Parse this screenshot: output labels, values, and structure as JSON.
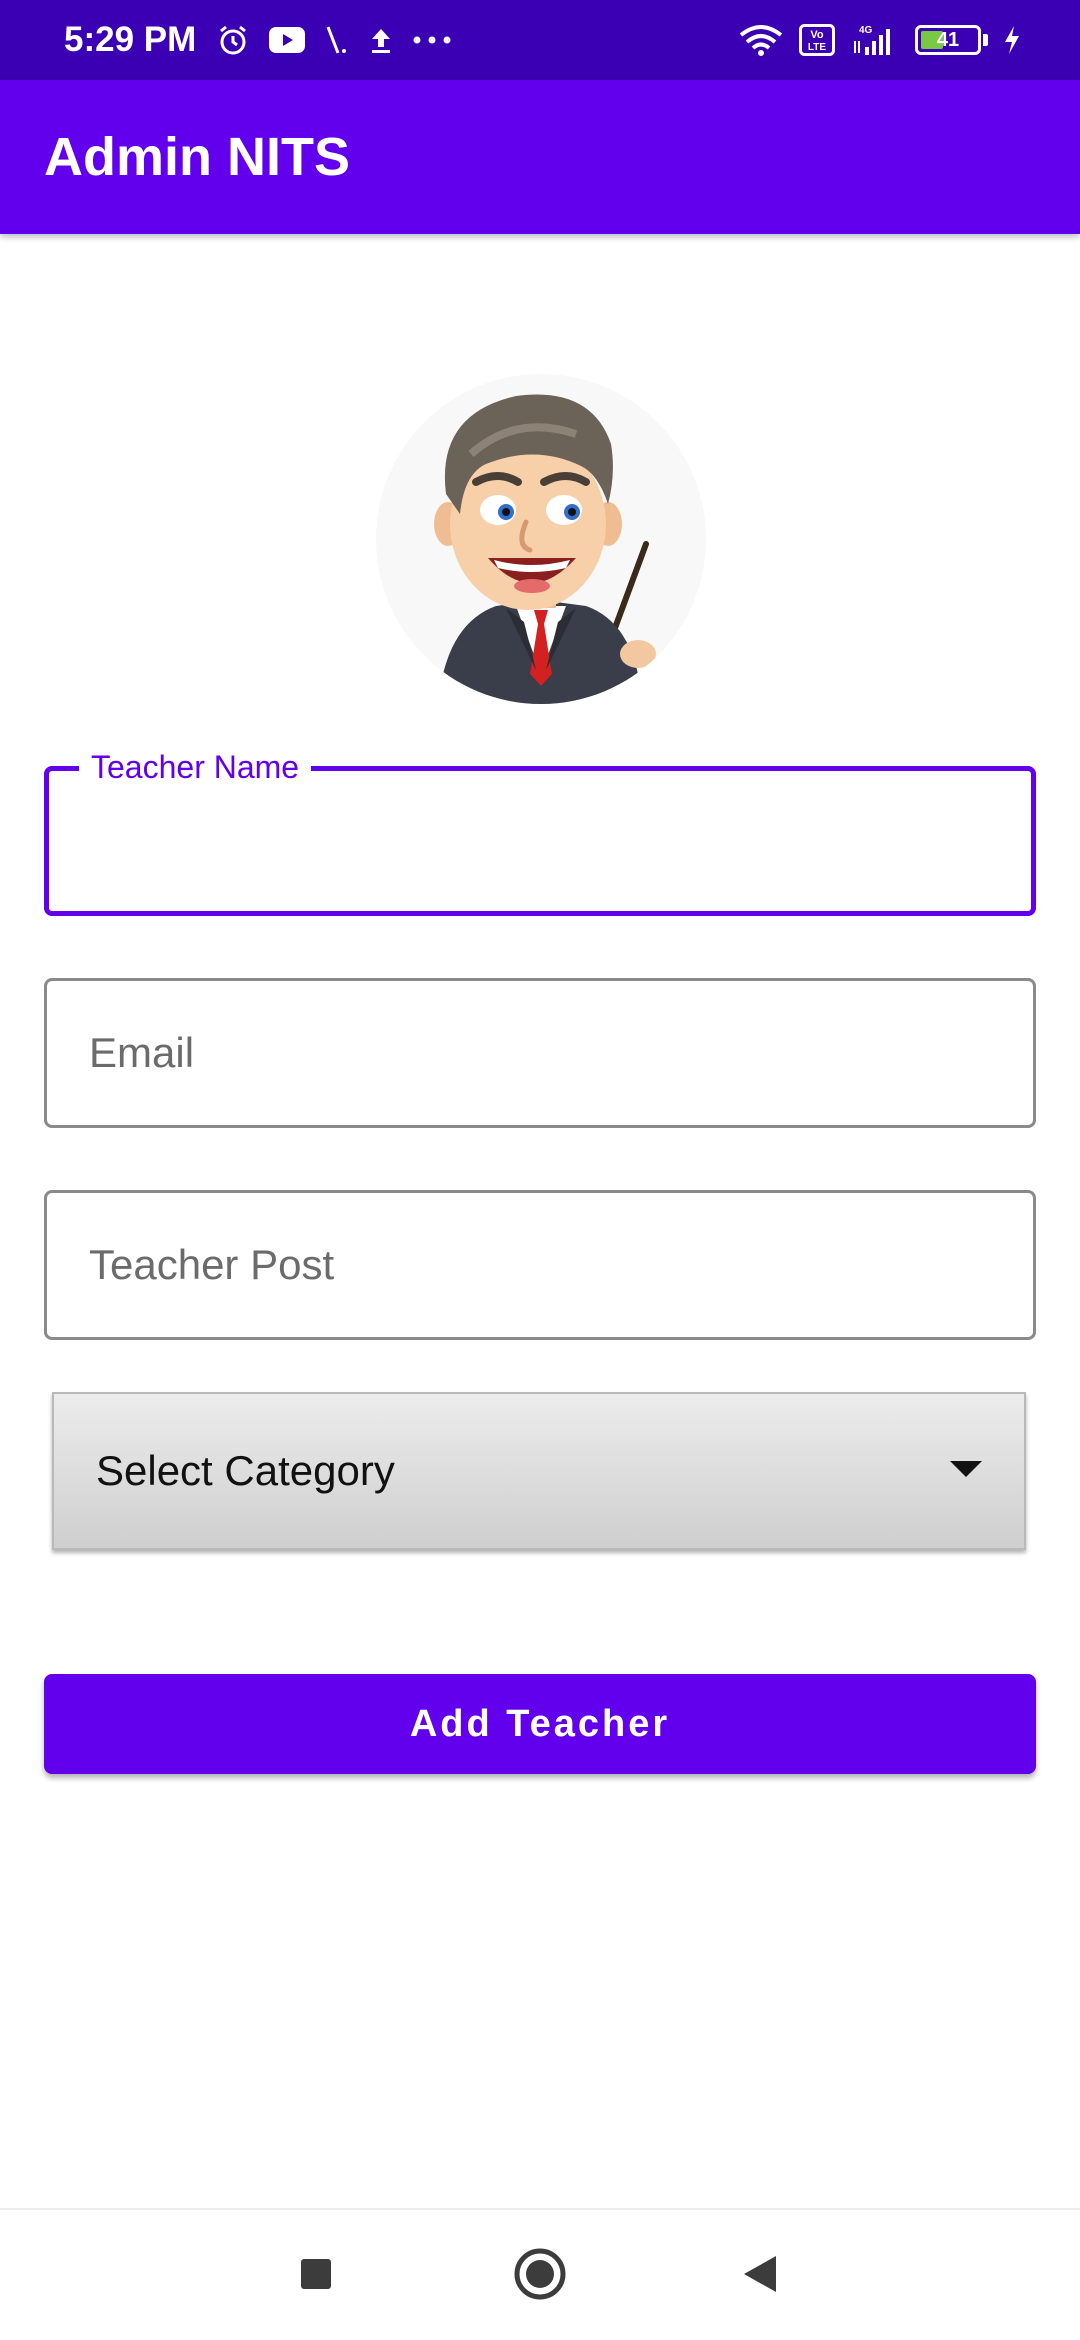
{
  "status_bar": {
    "time": "5:29 PM",
    "battery_level": "41",
    "battery_fraction": 0.41,
    "left_icons": [
      "alarm-icon",
      "youtube-icon",
      "slash-icon",
      "upload-icon",
      "more-icon"
    ],
    "right_icons": [
      "wifi-icon",
      "volte-icon",
      "signal-4g-icon",
      "battery-icon",
      "charging-icon"
    ],
    "network_labels": {
      "volte_top": "Vo",
      "volte_bottom": "LTE",
      "network_type": "4G"
    }
  },
  "app_bar": {
    "title": "Admin NITS"
  },
  "form": {
    "avatar_icon": "teacher-avatar",
    "teacher_name": {
      "label": "Teacher Name",
      "value": ""
    },
    "email": {
      "placeholder": "Email",
      "value": ""
    },
    "teacher_post": {
      "placeholder": "Teacher Post",
      "value": ""
    },
    "category": {
      "selected": "Select Category"
    },
    "submit_label": "Add Teacher"
  },
  "nav_bar": {
    "icons": [
      "recents-icon",
      "home-icon",
      "back-icon"
    ]
  },
  "colors": {
    "primary": "#6200ee",
    "status_bar": "#3b00b3",
    "outline": "#8a8a8a"
  }
}
